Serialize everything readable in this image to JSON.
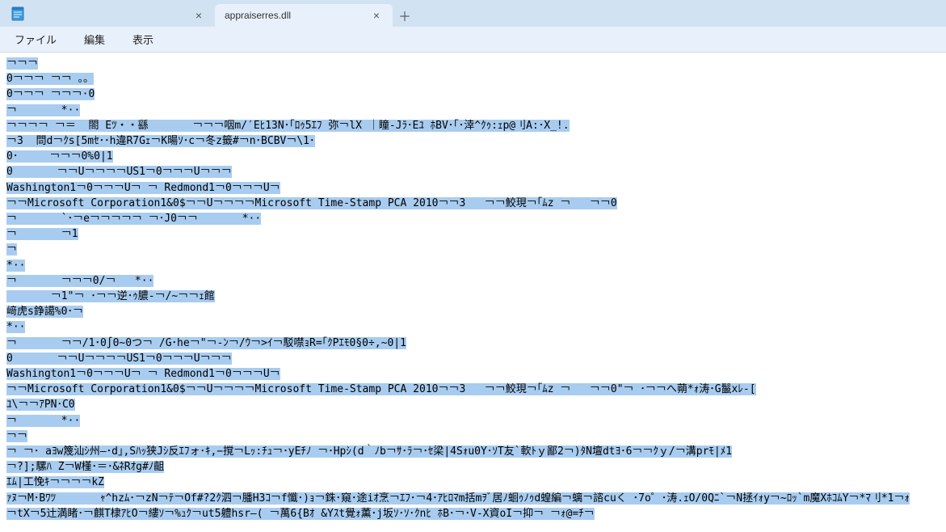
{
  "titlebar": {
    "tabs": [
      {
        "label": "",
        "active": false
      },
      {
        "label": "appraiserres.dll",
        "active": true
      }
    ]
  },
  "menubar": {
    "file": "ファイル",
    "edit": "編集",
    "view": "表示"
  },
  "lines": [
    "￢￢￢",
    "0￢￢￢ ￢￢ 。。",
    "0￢￢￢ ￢￢￢·0",
    "￢       *··",
    "￢￢￢￢ ￢＝  閤 Eﾂ・・繇       ￢￢￢咽m/′Eﾋ13N･｢ﾛｩ5ｴﾌ 弥￢lX ｜瞳-Jﾗ･Eﾕ ﾎBV･｢･涬^ｸｩ:ｪp@刂A:･X_!.",
    "￢3  問d￢ｸs[5mｾ･･h違R7Gｪ￢K暘ｿ･c￢冬z籤#￢n･BCBV￢\\1･",
    "0･     ￢￢￢0%0|1",
    "0       ￢￢U￢￢￢￢US1￢0￢￢￢U￢￢￢",
    "Washington1￢0￢￢￢U￢ ￢ Redmond1￢0￢￢￢U￢",
    "￢￢Microsoft Corporation1&0$￢￢U￢￢￢￢Microsoft Time-Stamp PCA 2010￢￢3   ￢￢鮫現￢｢ﾑz ￢   ￢￢0",
    "￢       `･￢e￢￢￢￢￢ ￢･J0￢￢       *··",
    "￢       ￢1",
    "￢",
    "*··",
    "￢       ￢￢￢0/￢   *··",
    "       ￢1\"￢ ･￢￢逆･ｩ膿-￢/~￢￢ｪ館",
    "﨑虎s錚譪%0･￢",
    "*··",
    "￢       ￢￢/1･0∫0~0つ￢ /G･he￢\"￢-ﾝ￢/ｳ￢>ｲ￢駁噤ｮR=｢ｸPｴﾓ0§0÷‚~0|1",
    "0       ￢￢U￢￢￢￢US1￢0￢￢￢U￢￢￢",
    "Washington1￢0￢￢￢U￢ ￢ Redmond1￢0￢￢￢U￢",
    "￢￢Microsoft Corporation1&0$￢￢U￢￢￢￢Microsoft Time-Stamp PCA 2010￢￢3   ￢￢鮫現￢｢ﾑz ￢   ￢￢0\"￢ ･￢￢へ蒴*ｫ涛･G鬣xﾚ-[",
    "ﾕ\\￢￢ｱPN･C0",
    "￢       *··",
    "￢￢",
    "￢ ￢･ aﾖw篾汕ｼ州—･d｣,Sﾊｯ狭Jｼ反ｴﾌォ･ｷ,−撹￢Lｯ:ﾁｭ￢･yEﾁﾉ ￢･Hpｼ(d｀ﾉb￢ｻ･ﾗ￢･ｾ梁|4Sｫu0Y･ｿT友`軟ﾄｙ鄙2￢)ﾀN壇dtﾖ･6￢￢ｸｙ/￢溝prﾓ|ﾒ1",
    "￢?];騾ﾊ Z￢W槿･＝･&ﾈRｵg#ﾉ齟",
    "ｴﾑ|工悗ｷ￢￢￢￢kZ",
    "ｧﾇ￢M･Bﾜﾂ       ｬ^hzﾑ･￢zN￢ﾃ￢Of#?2ｸ泗￢膰H3ｺ￢f懺･)ｮ￢銖･窺･途iｵ烹￢ｴﾌ･￢4･ｱﾋﾛﾏm括mｦﾞ居ﾉ蛔ｩﾉｩd蝗編￢螭￢諮cuく ･7o゜･涛.ｪO/0Qﾆ`￢N拯ｲｫy￢~ﾛｯ`m魔XﾎｺﾑY￢*ﾏ刂*1￢ｫ",
    "￢tX￢5辻満睹･￢麒T棣ｱﾋO￢縷ｿ￢%ｭｸ￢ut5軆hsr—( ￢萬6{Bｵ &Yｽt覺ｫ薫･j坂ｿ･ｿ･ｸnﾋ ﾎB･￢･V-X資oI￢抑￢ ￢ｫ@=ﾁ￢"
  ]
}
